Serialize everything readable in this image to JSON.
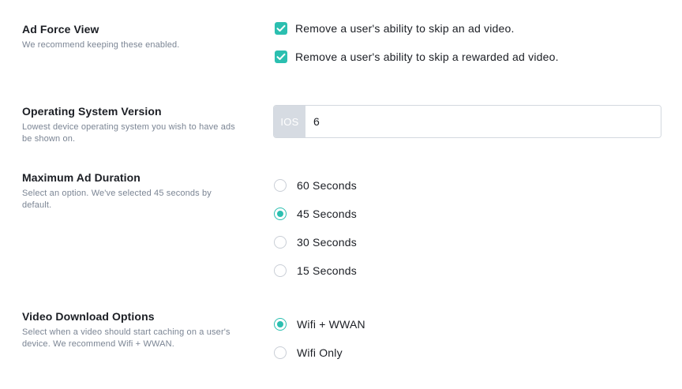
{
  "ad_force_view": {
    "title": "Ad Force View",
    "description": "We recommend keeping these enabled.",
    "options": [
      {
        "label": "Remove a user's ability to skip an ad video.",
        "checked": true
      },
      {
        "label": "Remove a user's ability to skip a rewarded ad video.",
        "checked": true
      }
    ]
  },
  "os_version": {
    "title": "Operating System Version",
    "description": "Lowest device operating system you wish to have ads be shown on.",
    "prefix": "IOS",
    "value": "6"
  },
  "max_ad_duration": {
    "title": "Maximum Ad Duration",
    "description": "Select an option. We've selected 45 seconds by default.",
    "options": [
      {
        "label": "60 Seconds",
        "selected": false
      },
      {
        "label": "45 Seconds",
        "selected": true
      },
      {
        "label": "30 Seconds",
        "selected": false
      },
      {
        "label": "15 Seconds",
        "selected": false
      }
    ]
  },
  "video_download": {
    "title": "Video Download Options",
    "description": "Select when a video should start caching on a user's device. We recommend Wifi + WWAN.",
    "options": [
      {
        "label": "Wifi + WWAN",
        "selected": true
      },
      {
        "label": "Wifi Only",
        "selected": false
      }
    ]
  },
  "colors": {
    "accent": "#2bbfb0",
    "text": "#1b1e24",
    "muted": "#7b8594"
  }
}
